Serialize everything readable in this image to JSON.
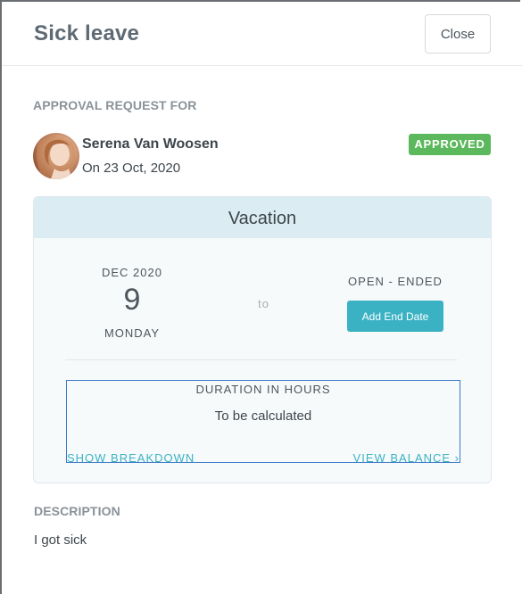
{
  "header": {
    "title": "Sick leave",
    "close_label": "Close"
  },
  "request": {
    "section_label": "APPROVAL REQUEST FOR",
    "name": "Serena Van Woosen",
    "date": "On 23 Oct, 2020",
    "status": "APPROVED",
    "status_color": "#5cb85c"
  },
  "leave_card": {
    "type": "Vacation",
    "start_month": "DEC 2020",
    "start_day": "9",
    "start_weekday": "MONDAY",
    "to_label": "to",
    "end_label": "OPEN - ENDED",
    "add_end_date_label": "Add End Date",
    "duration_label": "DURATION IN HOURS",
    "duration_value": "To be calculated",
    "show_breakdown_label": "SHOW BREAKDOWN",
    "view_balance_label": "VIEW BALANCE ›",
    "accent_color": "#3bb2c4"
  },
  "description": {
    "label": "DESCRIPTION",
    "text": "I got sick"
  }
}
